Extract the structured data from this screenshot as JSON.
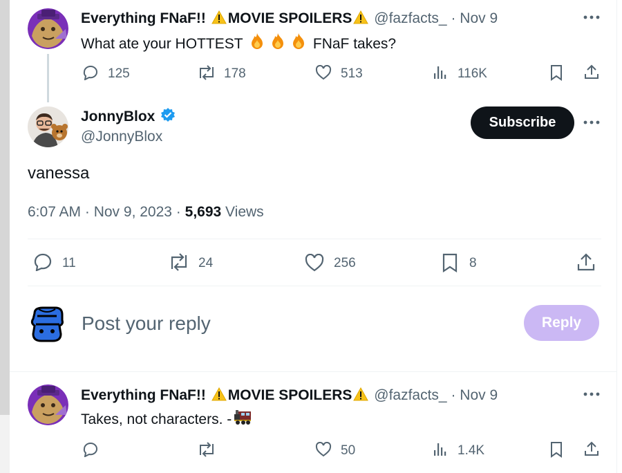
{
  "colors": {
    "text_primary": "#0f1419",
    "text_secondary": "#536471",
    "verified_blue": "#1d9bf0",
    "subscribe_bg": "#0f1419",
    "reply_button_bg": "#cbb8f4",
    "separator": "#eff3f4"
  },
  "parent_tweet": {
    "display_name_part1": "Everything FNaF!!",
    "display_name_part2": "MOVIE SPOILERS",
    "handle": "@fazfacts_",
    "date": "· Nov 9",
    "text_before": "What ate your HOTTEST",
    "emojis": [
      "fire-icon",
      "fire-icon",
      "fire-icon"
    ],
    "text_after": "FNaF takes?",
    "stats": {
      "replies": "125",
      "reposts": "178",
      "likes": "513",
      "views": "116K"
    }
  },
  "main_tweet": {
    "display_name": "JonnyBlox",
    "verified": true,
    "handle": "@JonnyBlox",
    "subscribe_label": "Subscribe",
    "text": "vanessa",
    "timestamp": "6:07 AM · Nov 9, 2023 ·",
    "views_count": "5,693",
    "views_label": "Views",
    "stats": {
      "replies": "11",
      "reposts": "24",
      "likes": "256",
      "bookmarks": "8"
    }
  },
  "composer": {
    "placeholder": "Post your reply",
    "reply_label": "Reply"
  },
  "reply_tweet": {
    "display_name_part1": "Everything FNaF!!",
    "display_name_part2": "MOVIE SPOILERS",
    "handle": "@fazfacts_",
    "date": "· Nov 9",
    "text": "Takes, not characters. -",
    "emoji": "train-icon",
    "stats": {
      "likes": "50",
      "views": "1.4K"
    }
  }
}
